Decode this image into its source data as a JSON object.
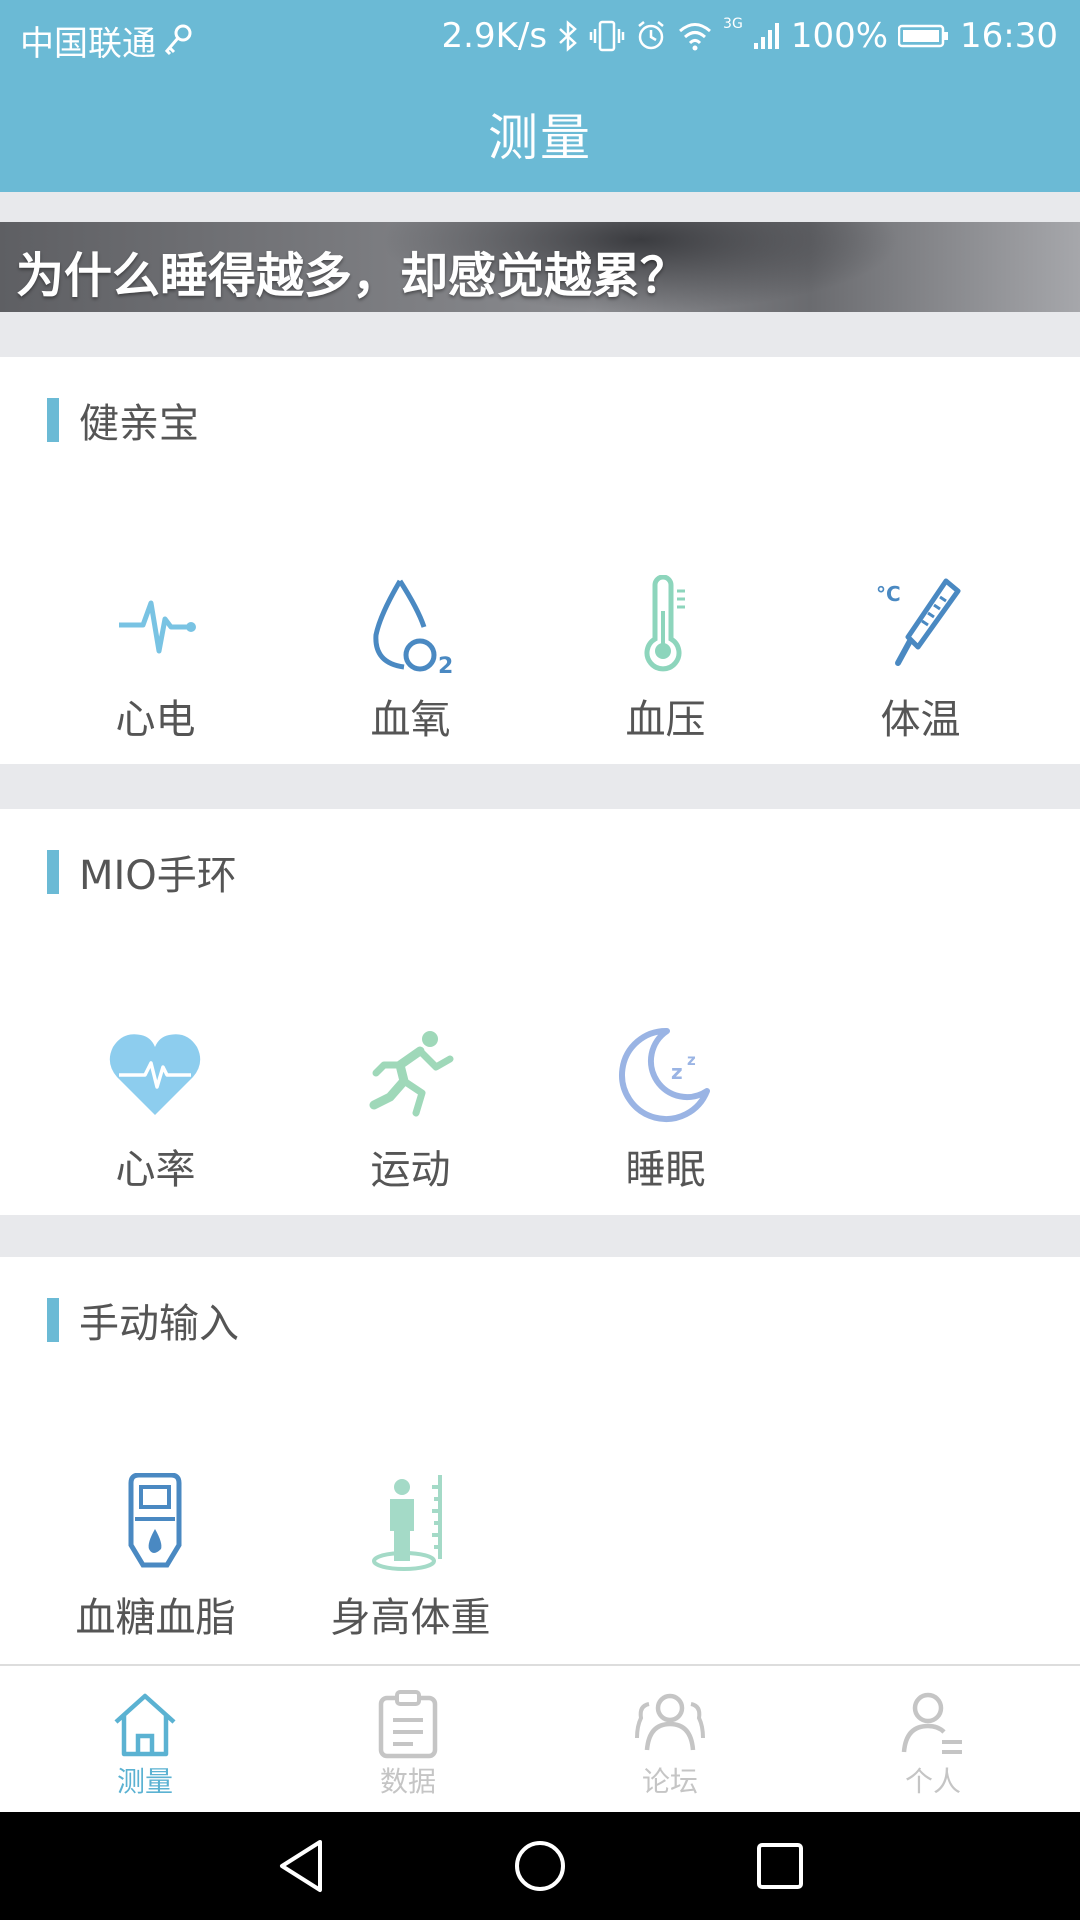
{
  "status_bar": {
    "carrier": "中国联通",
    "net_speed": "2.9K/s",
    "network_type": "3G",
    "battery": "100%",
    "time": "16:30"
  },
  "header": {
    "title": "测量"
  },
  "banner": {
    "text": "为什么睡得越多，却感觉越累？"
  },
  "sections": [
    {
      "title": "健亲宝",
      "items": [
        {
          "label": "心电",
          "icon": "ecg-icon"
        },
        {
          "label": "血氧",
          "icon": "blood-oxygen-icon"
        },
        {
          "label": "血压",
          "icon": "thermometer-icon"
        },
        {
          "label": "体温",
          "icon": "clinical-thermometer-icon"
        }
      ]
    },
    {
      "title": "MIO手环",
      "items": [
        {
          "label": "心率",
          "icon": "heart-rate-icon"
        },
        {
          "label": "运动",
          "icon": "running-icon"
        },
        {
          "label": "睡眠",
          "icon": "moon-sleep-icon"
        }
      ]
    },
    {
      "title": "手动输入",
      "items": [
        {
          "label": "血糖血脂",
          "icon": "glucose-meter-icon"
        },
        {
          "label": "身高体重",
          "icon": "height-scale-icon"
        }
      ]
    }
  ],
  "tabs": [
    {
      "label": "测量",
      "icon": "home-icon",
      "active": true
    },
    {
      "label": "数据",
      "icon": "clipboard-icon",
      "active": false
    },
    {
      "label": "论坛",
      "icon": "people-icon",
      "active": false
    },
    {
      "label": "个人",
      "icon": "person-icon",
      "active": false
    }
  ],
  "colors": {
    "accent": "#6bbad5",
    "tab_active": "#5bb2d2",
    "tab_inactive": "#c5c5c5",
    "background": "#e8e9ec"
  }
}
